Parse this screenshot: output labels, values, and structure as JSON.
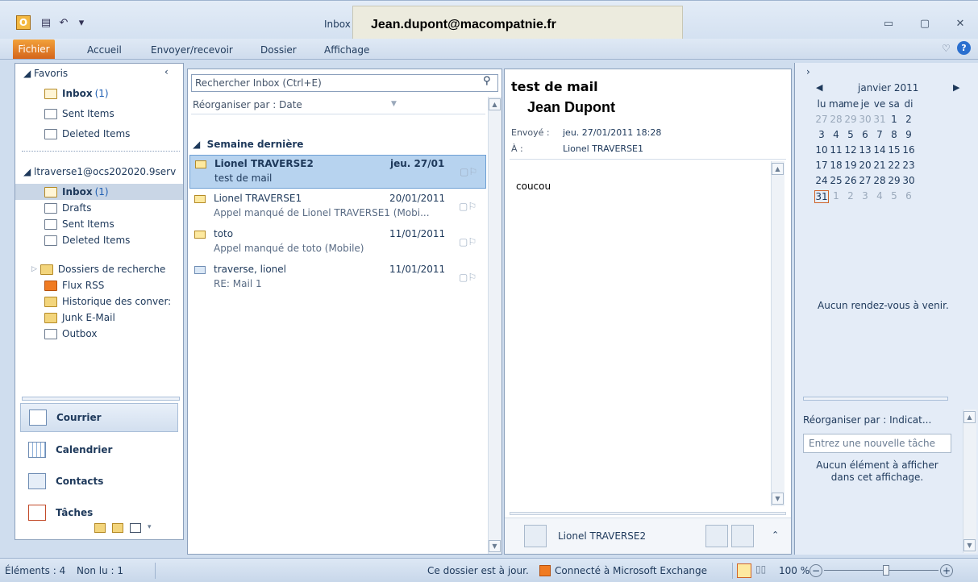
{
  "window": {
    "title": "Inbox",
    "email_overlay": "Jean.dupont@macompatnie.fr"
  },
  "ribbon": {
    "tabs": [
      "Fichier",
      "Accueil",
      "Envoyer/recevoir",
      "Dossier",
      "Affichage"
    ]
  },
  "folders": {
    "favorites_label": "Favoris",
    "favorites": [
      {
        "name": "Inbox",
        "count": "(1)"
      },
      {
        "name": "Sent Items"
      },
      {
        "name": "Deleted Items"
      }
    ],
    "account_label": "ltraverse1@ocs202020.9serv",
    "account_folders": [
      {
        "name": "Inbox",
        "count": "(1)"
      },
      {
        "name": "Drafts"
      },
      {
        "name": "Sent Items"
      },
      {
        "name": "Deleted Items"
      },
      {
        "name": "Dossiers de recherche"
      },
      {
        "name": "Flux RSS"
      },
      {
        "name": "Historique des conver:"
      },
      {
        "name": "Junk E-Mail"
      },
      {
        "name": "Outbox"
      }
    ]
  },
  "nav": {
    "mail": "Courrier",
    "calendar": "Calendrier",
    "contacts": "Contacts",
    "tasks": "Tâches"
  },
  "messages": {
    "search_placeholder": "Rechercher Inbox (Ctrl+E)",
    "arrange": "Réorganiser par : Date",
    "group": "Semaine dernière",
    "items": [
      {
        "from": "Lionel TRAVERSE2",
        "date": "jeu. 27/01",
        "subject": "test de mail"
      },
      {
        "from": "Lionel TRAVERSE1",
        "date": "20/01/2011",
        "subject": "Appel manqué de Lionel TRAVERSE1 (Mobi..."
      },
      {
        "from": "toto",
        "date": "11/01/2011",
        "subject": "Appel manqué de toto (Mobile)"
      },
      {
        "from": "traverse, lionel",
        "date": "11/01/2011",
        "subject": "RE: Mail 1"
      }
    ]
  },
  "reading": {
    "subject": "test de mail",
    "sender": "Jean Dupont",
    "sent_label": "Envoyé :",
    "sent_value": "jeu. 27/01/2011 18:28",
    "to_label": "À :",
    "to_value": "Lionel TRAVERSE1",
    "body": "coucou",
    "people_name": "Lionel TRAVERSE2"
  },
  "todo": {
    "month": "janvier 2011",
    "weekdays": [
      "lu",
      "ma",
      "me",
      "je",
      "ve",
      "sa",
      "di"
    ],
    "weeks": [
      [
        "27",
        "28",
        "29",
        "30",
        "31",
        "1",
        "2"
      ],
      [
        "3",
        "4",
        "5",
        "6",
        "7",
        "8",
        "9"
      ],
      [
        "10",
        "11",
        "12",
        "13",
        "14",
        "15",
        "16"
      ],
      [
        "17",
        "18",
        "19",
        "20",
        "21",
        "22",
        "23"
      ],
      [
        "24",
        "25",
        "26",
        "27",
        "28",
        "29",
        "30"
      ],
      [
        "31",
        "1",
        "2",
        "3",
        "4",
        "5",
        "6"
      ]
    ],
    "no_appointments": "Aucun rendez-vous à venir.",
    "arrange": "Réorganiser par : Indicat...",
    "new_task_placeholder": "Entrez une nouvelle tâche",
    "empty": "Aucun élément à afficher dans cet affichage."
  },
  "status": {
    "elements": "Éléments : 4",
    "unread": "Non lu : 1",
    "uptodate": "Ce dossier est à jour.",
    "connected": "Connecté à Microsoft Exchange",
    "zoom": "100 %"
  }
}
